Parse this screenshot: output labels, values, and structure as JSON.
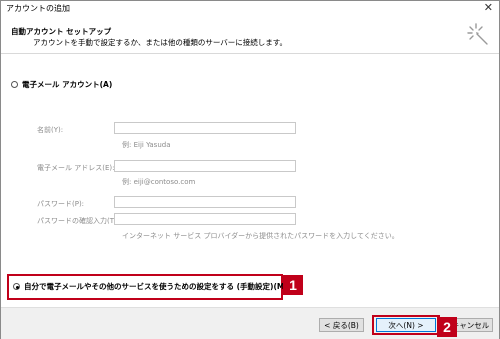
{
  "window": {
    "title": "アカウントの追加",
    "close_glyph": "✕"
  },
  "header": {
    "title": "自動アカウント セットアップ",
    "subtitle": "アカウントを手動で設定するか、または他の種類のサーバーに接続します。",
    "icon": "wizard-sparkle-icon"
  },
  "email_option": {
    "label": "電子メール アカウント(A)",
    "selected": false
  },
  "fields": [
    {
      "label": "名前(Y):",
      "value": "",
      "example": "例: Eiji Yasuda"
    },
    {
      "label": "電子メール アドレス(E):",
      "value": "",
      "example": "例: eiji@contoso.com"
    },
    {
      "label": "パスワード(P):",
      "value": "",
      "example": ""
    },
    {
      "label": "パスワードの確認入力(T):",
      "value": "",
      "example": ""
    }
  ],
  "password_note": "インターネット サービス プロバイダーから提供されたパスワードを入力してください。",
  "manual_option": {
    "label": "自分で電子メールやその他のサービスを使うための設定をする (手動設定)(M)",
    "selected": true
  },
  "badges": {
    "one": "1",
    "two": "2"
  },
  "buttons": {
    "back": "< 戻る(B)",
    "next": "次へ(N) >",
    "cancel": "キャンセル"
  },
  "colors": {
    "highlight": "#c0001a"
  }
}
